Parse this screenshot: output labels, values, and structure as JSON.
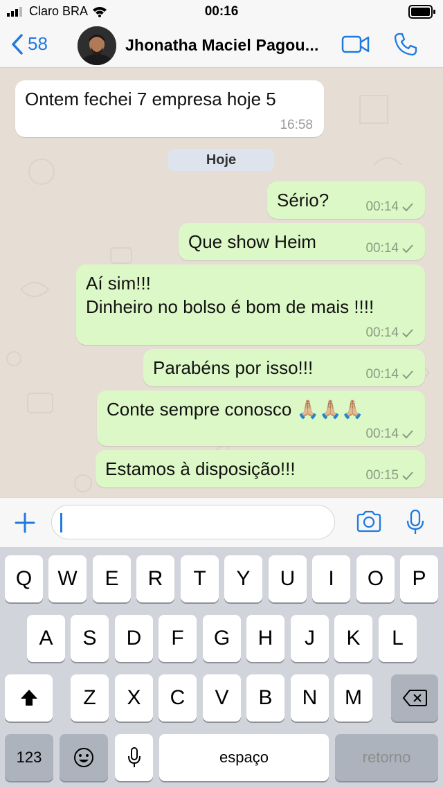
{
  "status_bar": {
    "carrier": "Claro BRA",
    "time": "00:16"
  },
  "header": {
    "back_count": "58",
    "contact_name": "Jhonatha Maciel Pagou..."
  },
  "chat": {
    "date_separator": "Hoje",
    "messages": [
      {
        "direction": "in",
        "lines": [
          "Ontem fechei 7 empresa hoje 5"
        ],
        "time": "16:58"
      },
      {
        "direction": "out",
        "lines": [
          "Sério?"
        ],
        "time": "00:14"
      },
      {
        "direction": "out",
        "lines": [
          "Que show Heim"
        ],
        "time": "00:14"
      },
      {
        "direction": "out",
        "lines": [
          "Aí sim!!!",
          "Dinheiro no bolso é bom de mais !!!!"
        ],
        "time": "00:14"
      },
      {
        "direction": "out",
        "lines": [
          "Parabéns por isso!!!"
        ],
        "time": "00:14"
      },
      {
        "direction": "out",
        "lines": [
          "Conte sempre conosco 🙏🏼🙏🏼🙏🏼"
        ],
        "time": "00:14"
      },
      {
        "direction": "out",
        "lines": [
          "Estamos à disposição!!!"
        ],
        "time": "00:15"
      }
    ]
  },
  "input": {
    "value": ""
  },
  "keyboard": {
    "row1": [
      "Q",
      "W",
      "E",
      "R",
      "T",
      "Y",
      "U",
      "I",
      "O",
      "P"
    ],
    "row2": [
      "A",
      "S",
      "D",
      "F",
      "G",
      "H",
      "J",
      "K",
      "L"
    ],
    "row3": [
      "Z",
      "X",
      "C",
      "V",
      "B",
      "N",
      "M"
    ],
    "numbers_label": "123",
    "space_label": "espaço",
    "return_label": "retorno"
  },
  "colors": {
    "accent": "#1f7ae0",
    "outgoing_bubble": "#dcf8c6",
    "incoming_bubble": "#ffffff",
    "chat_background": "#e6ddd4"
  },
  "icons": [
    "signal-icon",
    "wifi-icon",
    "battery-icon",
    "back-chevron-icon",
    "video-call-icon",
    "phone-icon",
    "plus-icon",
    "camera-icon",
    "microphone-icon",
    "shift-icon",
    "backspace-icon",
    "emoji-icon",
    "dictation-icon",
    "read-check-icon"
  ]
}
